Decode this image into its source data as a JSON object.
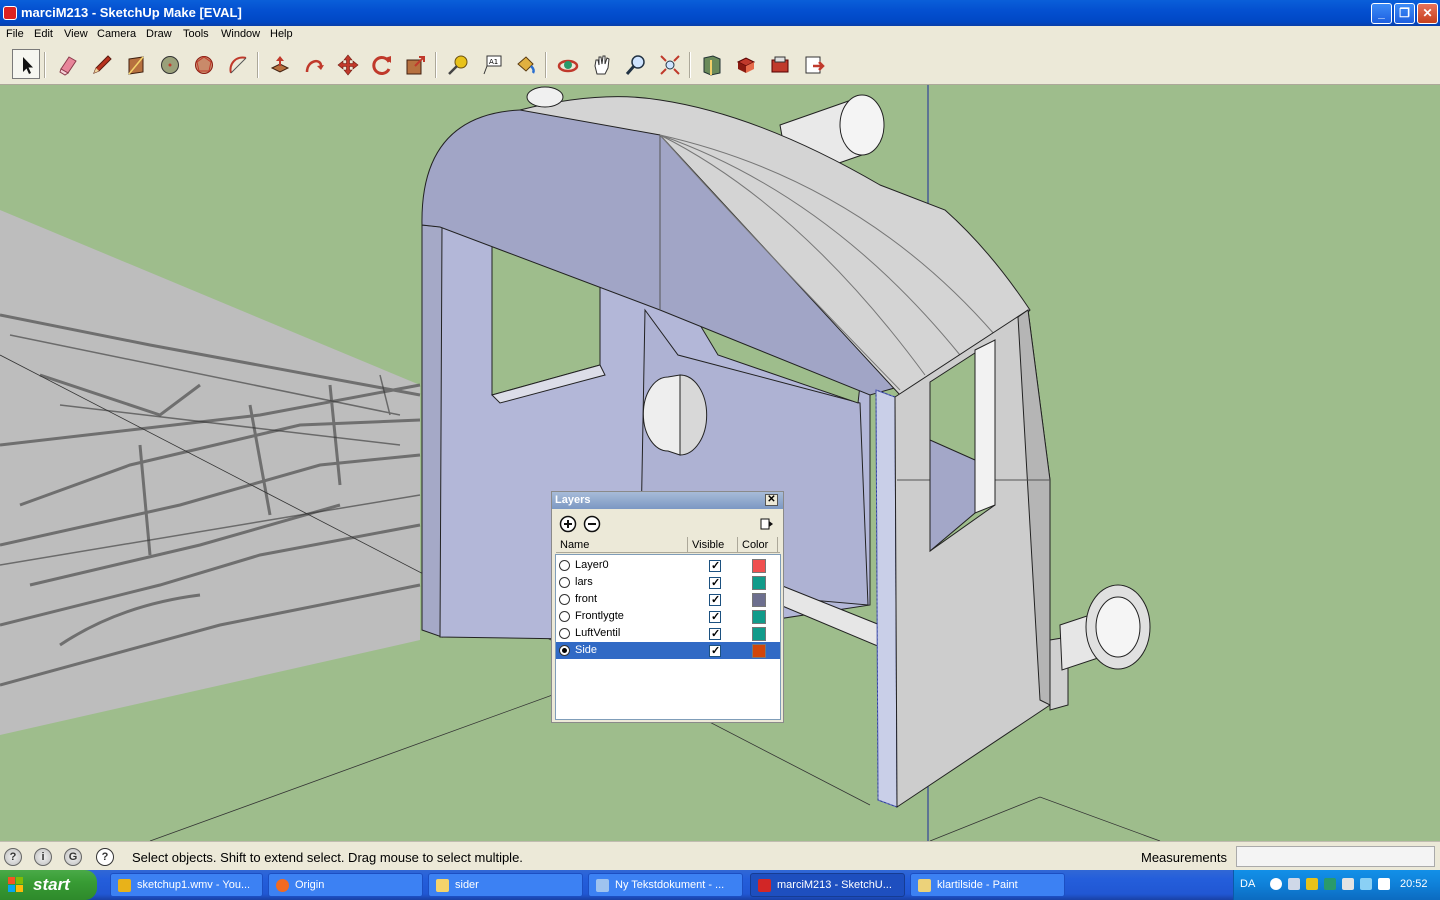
{
  "window": {
    "title": "marciM213 - SketchUp Make [EVAL]",
    "controls": {
      "minimize": "_",
      "maximize": "❐",
      "close": "✕"
    }
  },
  "menu": [
    "File",
    "Edit",
    "View",
    "Camera",
    "Draw",
    "Tools",
    "Window",
    "Help"
  ],
  "toolbar": {
    "tools": [
      "select-icon",
      "eraser-icon",
      "pencil-icon",
      "rectangle-icon",
      "circle-icon",
      "polygon-icon",
      "arc-icon",
      "push-pull-icon",
      "follow-me-icon",
      "move-icon",
      "rotate-icon",
      "scale-icon",
      "tape-measure-icon",
      "text-icon",
      "paint-bucket-icon",
      "orbit-icon",
      "pan-icon",
      "zoom-icon",
      "zoom-extents-icon",
      "warehouse-icon",
      "components-icon",
      "extension-warehouse-icon",
      "share-model-icon"
    ],
    "active_tool": "select-icon"
  },
  "layers_panel": {
    "title": "Layers",
    "close": "✕",
    "columns": {
      "name": "Name",
      "visible": "Visible",
      "color": "Color"
    },
    "layers": [
      {
        "name": "Layer0",
        "visible": true,
        "color": "#f05050",
        "active": false
      },
      {
        "name": "lars",
        "visible": true,
        "color": "#119b8a",
        "active": false
      },
      {
        "name": "front",
        "visible": true,
        "color": "#6d6f8f",
        "active": false
      },
      {
        "name": "Frontlygte",
        "visible": true,
        "color": "#119b8a",
        "active": false
      },
      {
        "name": "LuftVentil",
        "visible": true,
        "color": "#119b8a",
        "active": false
      },
      {
        "name": "Side",
        "visible": true,
        "color": "#d2460a",
        "active": true
      }
    ]
  },
  "statusbar": {
    "icons": [
      "geo-location-icon",
      "credits-icon",
      "sign-in-icon",
      "help-icon"
    ],
    "message": "Select objects. Shift to extend select. Drag mouse to select multiple.",
    "measurements_label": "Measurements",
    "measurements_value": ""
  },
  "taskbar": {
    "start_label": "start",
    "tasks": [
      {
        "label": "sketchup1.wmv - You...",
        "icon": "chrome-icon",
        "color": "#e8b21a",
        "active": false
      },
      {
        "label": "Origin",
        "icon": "origin-icon",
        "color": "#f26a21",
        "active": false
      },
      {
        "label": "sider",
        "icon": "folder-icon",
        "color": "#f5d36b",
        "active": false
      },
      {
        "label": "Ny Tekstdokument - ...",
        "icon": "notepad-icon",
        "color": "#9fc3ef",
        "active": false
      },
      {
        "label": "marciM213 - SketchU...",
        "icon": "sketchup-icon",
        "color": "#d22626",
        "active": true
      },
      {
        "label": "klartilside - Paint",
        "icon": "paint-icon",
        "color": "#ecd27a",
        "active": false
      }
    ],
    "tray": {
      "language": "DA",
      "clock": "20:52"
    }
  }
}
